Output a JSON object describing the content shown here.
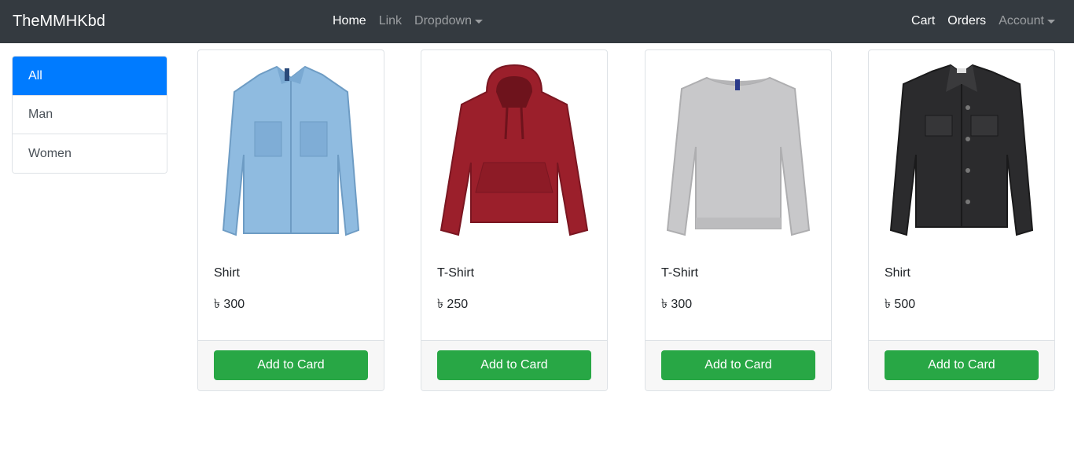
{
  "navbar": {
    "brand": "TheMMHKbd",
    "links": [
      {
        "label": "Home"
      },
      {
        "label": "Link"
      },
      {
        "label": "Dropdown"
      }
    ],
    "right_links": [
      {
        "label": "Cart"
      },
      {
        "label": "Orders"
      },
      {
        "label": "Account"
      }
    ]
  },
  "sidebar": {
    "items": [
      {
        "label": "All",
        "active": true
      },
      {
        "label": "Man"
      },
      {
        "label": "Women"
      }
    ]
  },
  "products": [
    {
      "name": "Shirt",
      "price": "৳ 300",
      "button": "Add to Card",
      "image": "denim-shirt-image",
      "color": "#8fbbe0"
    },
    {
      "name": "T-Shirt",
      "price": "৳ 250",
      "button": "Add to Card",
      "image": "red-hoodie-image",
      "color": "#9b1f2b"
    },
    {
      "name": "T-Shirt",
      "price": "৳ 300",
      "button": "Add to Card",
      "image": "grey-sweatshirt-image",
      "color": "#c8c8ca"
    },
    {
      "name": "Shirt",
      "price": "৳ 500",
      "button": "Add to Card",
      "image": "black-denim-jacket-image",
      "color": "#2b2b2d"
    }
  ],
  "colors": {
    "navbar_bg": "#343a40",
    "primary": "#007bff",
    "success": "#28a745"
  }
}
